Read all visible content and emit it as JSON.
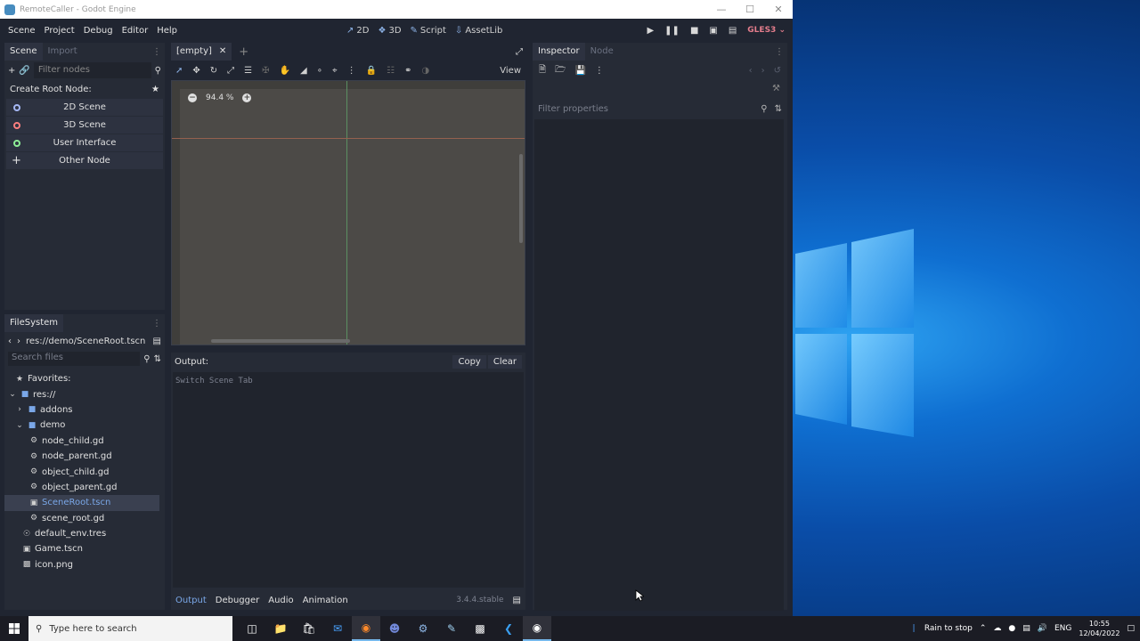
{
  "window": {
    "title": "RemoteCaller - Godot Engine"
  },
  "menu": [
    "Scene",
    "Project",
    "Debug",
    "Editor",
    "Help"
  ],
  "modes": {
    "mode_2d": "2D",
    "mode_3d": "3D",
    "script": "Script",
    "assetlib": "AssetLib"
  },
  "renderer": "GLES3",
  "scene_dock": {
    "tabs": [
      "Scene",
      "Import"
    ],
    "filter_placeholder": "Filter nodes",
    "create_root_label": "Create Root Node:",
    "root_buttons": [
      "2D Scene",
      "3D Scene",
      "User Interface",
      "Other Node"
    ]
  },
  "filesystem": {
    "title": "FileSystem",
    "path": "res://demo/SceneRoot.tscn",
    "search_placeholder": "Search files",
    "items": [
      {
        "label": "Favorites:",
        "icon": "star-icon"
      },
      {
        "label": "res://",
        "icon": "folder-icon"
      },
      {
        "label": "addons",
        "icon": "folder-icon"
      },
      {
        "label": "demo",
        "icon": "folder-icon"
      },
      {
        "label": "node_child.gd",
        "icon": "gear-icon"
      },
      {
        "label": "node_parent.gd",
        "icon": "gear-icon"
      },
      {
        "label": "object_child.gd",
        "icon": "gear-icon"
      },
      {
        "label": "object_parent.gd",
        "icon": "gear-icon"
      },
      {
        "label": "SceneRoot.tscn",
        "icon": "scene-icon"
      },
      {
        "label": "scene_root.gd",
        "icon": "gear-icon"
      },
      {
        "label": "default_env.tres",
        "icon": "globe-icon"
      },
      {
        "label": "Game.tscn",
        "icon": "scene-icon"
      },
      {
        "label": "icon.png",
        "icon": "image-icon"
      }
    ]
  },
  "viewport": {
    "tab_label": "[empty]",
    "zoom": "94.4 %",
    "view_label": "View"
  },
  "output": {
    "title": "Output:",
    "copy": "Copy",
    "clear": "Clear",
    "log_line": "Switch Scene Tab",
    "bottom_tabs": [
      "Output",
      "Debugger",
      "Audio",
      "Animation"
    ],
    "version": "3.4.4.stable"
  },
  "inspector": {
    "tabs": [
      "Inspector",
      "Node"
    ],
    "filter_placeholder": "Filter properties"
  },
  "taskbar": {
    "search_placeholder": "Type here to search",
    "weather": "Rain to stop",
    "language": "ENG",
    "time": "10:55",
    "date": "12/04/2022"
  }
}
